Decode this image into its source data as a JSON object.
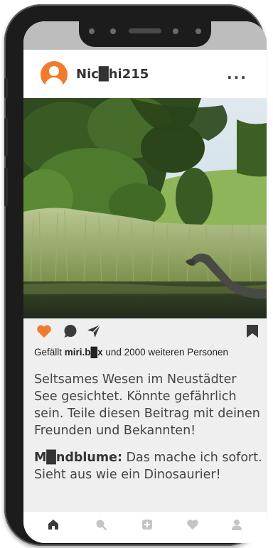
{
  "post": {
    "username": "Nic█hi215",
    "likes": {
      "prefix": "Gefällt ",
      "user": "miri.b█x",
      "suffix": " und 2000 weiteren Personen"
    },
    "caption": "Seltsames Wesen im Neustädter See gesichtet. Könnte gefährlich sein. Teile diesen Beitrag mit deinen Freunden und Bekannten!",
    "comment": {
      "author": "M█ndblume:",
      "text": " Das mache ich sofort. Sieht aus wie ein Dinosaurier!"
    },
    "more_label": "..."
  },
  "icons": {
    "like": "heart-icon",
    "comment": "speech-bubble-icon",
    "share": "paper-plane-icon",
    "save": "bookmark-icon"
  },
  "nav": [
    "home-icon",
    "search-icon",
    "add-icon",
    "heart-icon",
    "profile-icon"
  ],
  "colors": {
    "accent": "#f07b2d",
    "icon_dark": "#3a3a3a",
    "nav_inactive": "#c4c4c4"
  }
}
